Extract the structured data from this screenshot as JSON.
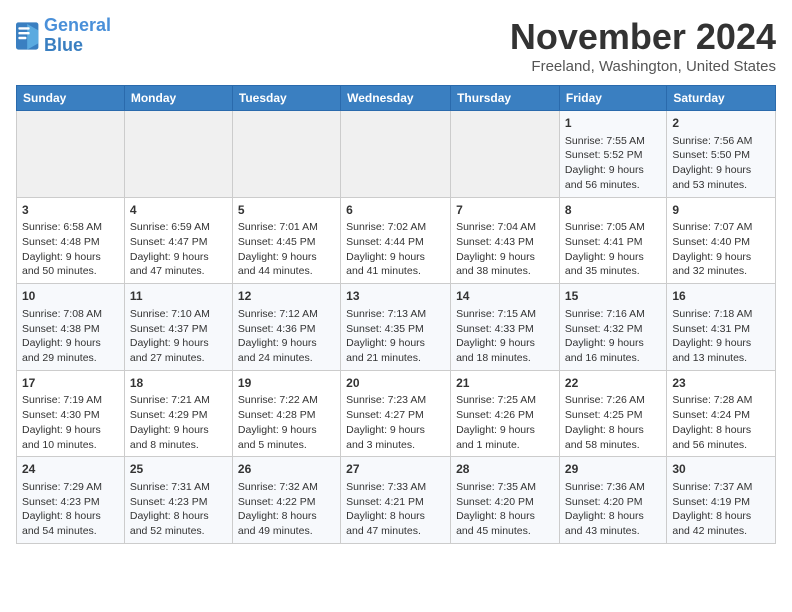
{
  "logo": {
    "line1": "General",
    "line2": "Blue"
  },
  "title": "November 2024",
  "location": "Freeland, Washington, United States",
  "days_of_week": [
    "Sunday",
    "Monday",
    "Tuesday",
    "Wednesday",
    "Thursday",
    "Friday",
    "Saturday"
  ],
  "weeks": [
    [
      {
        "day": "",
        "info": ""
      },
      {
        "day": "",
        "info": ""
      },
      {
        "day": "",
        "info": ""
      },
      {
        "day": "",
        "info": ""
      },
      {
        "day": "",
        "info": ""
      },
      {
        "day": "1",
        "info": "Sunrise: 7:55 AM\nSunset: 5:52 PM\nDaylight: 9 hours and 56 minutes."
      },
      {
        "day": "2",
        "info": "Sunrise: 7:56 AM\nSunset: 5:50 PM\nDaylight: 9 hours and 53 minutes."
      }
    ],
    [
      {
        "day": "3",
        "info": "Sunrise: 6:58 AM\nSunset: 4:48 PM\nDaylight: 9 hours and 50 minutes."
      },
      {
        "day": "4",
        "info": "Sunrise: 6:59 AM\nSunset: 4:47 PM\nDaylight: 9 hours and 47 minutes."
      },
      {
        "day": "5",
        "info": "Sunrise: 7:01 AM\nSunset: 4:45 PM\nDaylight: 9 hours and 44 minutes."
      },
      {
        "day": "6",
        "info": "Sunrise: 7:02 AM\nSunset: 4:44 PM\nDaylight: 9 hours and 41 minutes."
      },
      {
        "day": "7",
        "info": "Sunrise: 7:04 AM\nSunset: 4:43 PM\nDaylight: 9 hours and 38 minutes."
      },
      {
        "day": "8",
        "info": "Sunrise: 7:05 AM\nSunset: 4:41 PM\nDaylight: 9 hours and 35 minutes."
      },
      {
        "day": "9",
        "info": "Sunrise: 7:07 AM\nSunset: 4:40 PM\nDaylight: 9 hours and 32 minutes."
      }
    ],
    [
      {
        "day": "10",
        "info": "Sunrise: 7:08 AM\nSunset: 4:38 PM\nDaylight: 9 hours and 29 minutes."
      },
      {
        "day": "11",
        "info": "Sunrise: 7:10 AM\nSunset: 4:37 PM\nDaylight: 9 hours and 27 minutes."
      },
      {
        "day": "12",
        "info": "Sunrise: 7:12 AM\nSunset: 4:36 PM\nDaylight: 9 hours and 24 minutes."
      },
      {
        "day": "13",
        "info": "Sunrise: 7:13 AM\nSunset: 4:35 PM\nDaylight: 9 hours and 21 minutes."
      },
      {
        "day": "14",
        "info": "Sunrise: 7:15 AM\nSunset: 4:33 PM\nDaylight: 9 hours and 18 minutes."
      },
      {
        "day": "15",
        "info": "Sunrise: 7:16 AM\nSunset: 4:32 PM\nDaylight: 9 hours and 16 minutes."
      },
      {
        "day": "16",
        "info": "Sunrise: 7:18 AM\nSunset: 4:31 PM\nDaylight: 9 hours and 13 minutes."
      }
    ],
    [
      {
        "day": "17",
        "info": "Sunrise: 7:19 AM\nSunset: 4:30 PM\nDaylight: 9 hours and 10 minutes."
      },
      {
        "day": "18",
        "info": "Sunrise: 7:21 AM\nSunset: 4:29 PM\nDaylight: 9 hours and 8 minutes."
      },
      {
        "day": "19",
        "info": "Sunrise: 7:22 AM\nSunset: 4:28 PM\nDaylight: 9 hours and 5 minutes."
      },
      {
        "day": "20",
        "info": "Sunrise: 7:23 AM\nSunset: 4:27 PM\nDaylight: 9 hours and 3 minutes."
      },
      {
        "day": "21",
        "info": "Sunrise: 7:25 AM\nSunset: 4:26 PM\nDaylight: 9 hours and 1 minute."
      },
      {
        "day": "22",
        "info": "Sunrise: 7:26 AM\nSunset: 4:25 PM\nDaylight: 8 hours and 58 minutes."
      },
      {
        "day": "23",
        "info": "Sunrise: 7:28 AM\nSunset: 4:24 PM\nDaylight: 8 hours and 56 minutes."
      }
    ],
    [
      {
        "day": "24",
        "info": "Sunrise: 7:29 AM\nSunset: 4:23 PM\nDaylight: 8 hours and 54 minutes."
      },
      {
        "day": "25",
        "info": "Sunrise: 7:31 AM\nSunset: 4:23 PM\nDaylight: 8 hours and 52 minutes."
      },
      {
        "day": "26",
        "info": "Sunrise: 7:32 AM\nSunset: 4:22 PM\nDaylight: 8 hours and 49 minutes."
      },
      {
        "day": "27",
        "info": "Sunrise: 7:33 AM\nSunset: 4:21 PM\nDaylight: 8 hours and 47 minutes."
      },
      {
        "day": "28",
        "info": "Sunrise: 7:35 AM\nSunset: 4:20 PM\nDaylight: 8 hours and 45 minutes."
      },
      {
        "day": "29",
        "info": "Sunrise: 7:36 AM\nSunset: 4:20 PM\nDaylight: 8 hours and 43 minutes."
      },
      {
        "day": "30",
        "info": "Sunrise: 7:37 AM\nSunset: 4:19 PM\nDaylight: 8 hours and 42 minutes."
      }
    ]
  ]
}
